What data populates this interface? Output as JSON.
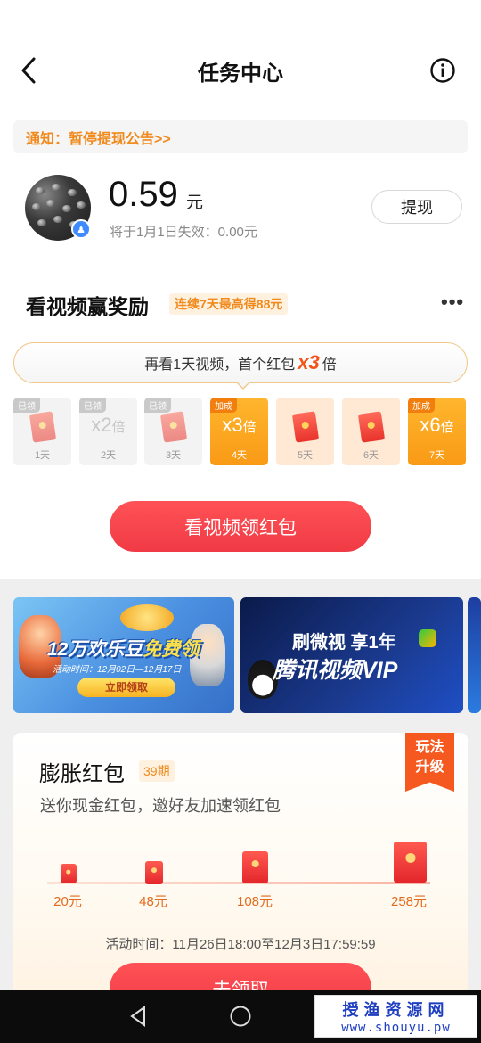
{
  "header": {
    "title": "任务中心"
  },
  "notice": {
    "text": "通知：暂停提现公告>>"
  },
  "balance": {
    "amount": "0.59",
    "unit": "元",
    "expire_text": "将于1月1日失效：0.00元",
    "withdraw_label": "提现"
  },
  "video_reward": {
    "title": "看视频赢奖励",
    "tag": "连续7天最高得88元",
    "tip_prefix": "再看1天视频，首个红包",
    "tip_multiplier": "x3",
    "tip_suffix": "倍",
    "days": [
      {
        "tag": "已领",
        "label": "1天",
        "kind": "envelope",
        "mult": "",
        "suffix": ""
      },
      {
        "tag": "已领",
        "label": "2天",
        "kind": "mult",
        "mult": "x2",
        "suffix": "倍"
      },
      {
        "tag": "已领",
        "label": "3天",
        "kind": "envelope",
        "mult": "",
        "suffix": ""
      },
      {
        "tag": "加成",
        "label": "4天",
        "kind": "mult",
        "mult": "x3",
        "suffix": "倍"
      },
      {
        "tag": "",
        "label": "5天",
        "kind": "envelope",
        "mult": "",
        "suffix": ""
      },
      {
        "tag": "",
        "label": "6天",
        "kind": "envelope",
        "mult": "",
        "suffix": ""
      },
      {
        "tag": "加成",
        "label": "7天",
        "kind": "mult",
        "mult": "x6",
        "suffix": "倍"
      }
    ],
    "watch_button_label": "看视频领红包"
  },
  "banners": {
    "banner1": {
      "title_a": "12万欢乐豆",
      "title_b": "免费领",
      "date": "活动时间：12月02日—12月17日",
      "button": "立即领取"
    },
    "banner2": {
      "line1": "刷微视 享1年",
      "line2": "腾讯视频VIP"
    }
  },
  "inflate": {
    "title": "膨胀红包",
    "period": "39期",
    "subtitle": "送你现金红包，邀好友加速领红包",
    "ribbon_line1": "玩法",
    "ribbon_line2": "升级",
    "steps": [
      {
        "label": "20元"
      },
      {
        "label": "48元"
      },
      {
        "label": "108元"
      },
      {
        "label": "258元"
      }
    ],
    "activity_time": "活动时间：11月26日18:00至12月3日17:59:59",
    "claim_label": "去领取"
  },
  "watermark": {
    "cn": "授渔资源网",
    "url": "www.shouyu.pw"
  },
  "colors": {
    "accent_red": "#f03a45",
    "accent_orange": "#f08a1c",
    "gold": "#f99a16"
  }
}
